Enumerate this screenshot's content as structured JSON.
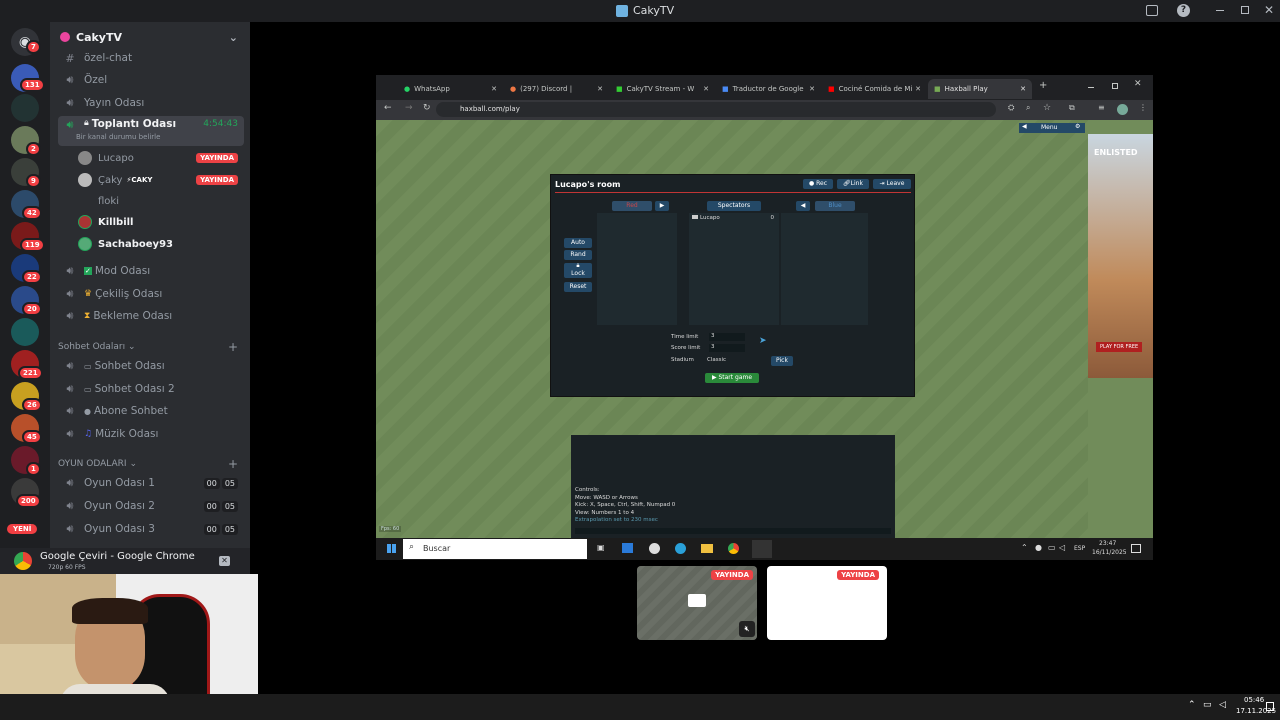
{
  "window": {
    "title": "CakyTV"
  },
  "servers": {
    "badges": [
      "7",
      "131",
      "2",
      "9",
      "42",
      "119",
      "22",
      "20",
      "221",
      "26",
      "45",
      "1",
      "200"
    ],
    "new_label": "YENİ"
  },
  "server": {
    "name": "CakyTV",
    "channels_top": [
      "özel-chat",
      "Özel",
      "Yayın Odası"
    ],
    "active_channel": {
      "name": "Toplantı Odası",
      "timer": "4:54:43",
      "status": "Bir kanal durumu belirle"
    },
    "members": [
      {
        "name": "Lucapo",
        "badge": "YAYINDA"
      },
      {
        "name": "Çaky",
        "tag": "⚡CAKY",
        "badge": "YAYINDA"
      },
      {
        "name": "floki"
      },
      {
        "name": "Killbill"
      },
      {
        "name": "Sachaboey93"
      }
    ],
    "channels_mid": [
      "Mod Odası",
      "Çekiliş Odası",
      "Bekleme Odası"
    ],
    "category_chat": "Sohbet Odaları",
    "chat_channels": [
      "Sohbet Odası",
      "Sohbet Odası 2",
      "Abone Sohbet",
      "Müzik Odası"
    ],
    "category_game": "OYUN ODALARI",
    "game_channels": [
      {
        "name": "Oyun Odası 1",
        "a": "00",
        "b": "05"
      },
      {
        "name": "Oyun Odası 2",
        "a": "00",
        "b": "05"
      },
      {
        "name": "Oyun Odası 3",
        "a": "00",
        "b": "05"
      }
    ]
  },
  "stream": {
    "title": "Google Çeviri - Google Chrome",
    "quality": "720p 60 FPS"
  },
  "browser": {
    "tabs": [
      "WhatsApp",
      "(297) Discord |",
      "CakyTV Stream - W",
      "Traductor de Google",
      "Cociné Comida de Mi",
      "Haxball Play"
    ],
    "url": "haxball.com/play",
    "menu_label": "Menu"
  },
  "haxball": {
    "room_title": "Lucapo's room",
    "buttons": {
      "rec": "Rec",
      "link": "Link",
      "leave": "Leave"
    },
    "teams": {
      "red": "Red",
      "spectators": "Spectators",
      "blue": "Blue"
    },
    "spectator": {
      "name": "Lucapo",
      "value": "0"
    },
    "side_buttons": [
      "Auto",
      "Rand",
      "Lock",
      "Reset"
    ],
    "settings": {
      "time_limit_label": "Time limit",
      "time_limit": "3",
      "score_limit_label": "Score limit",
      "score_limit": "3",
      "stadium_label": "Stadium",
      "stadium": "Classic",
      "pick": "Pick"
    },
    "start": "Start game",
    "controls": [
      "Controls:",
      "Move: WASD or Arrows",
      "Kick: X, Space, Ctrl, Shift, Numpad 0",
      "View: Numbers 1 to 4"
    ],
    "extrapolation": "Extrapolation set to 230 msec",
    "fps": "Fps: 60",
    "ad": {
      "title": "ENLISTED",
      "cta": "PLAY FOR FREE"
    }
  },
  "inner_taskbar": {
    "search": "Buscar",
    "lang": "ESP",
    "time": "23:47",
    "date": "16/11/2025"
  },
  "thumbnails": {
    "live1": "YAYINDA",
    "live2": "YAYINDA"
  },
  "system": {
    "time": "05:46",
    "date": "17.11.2025"
  }
}
